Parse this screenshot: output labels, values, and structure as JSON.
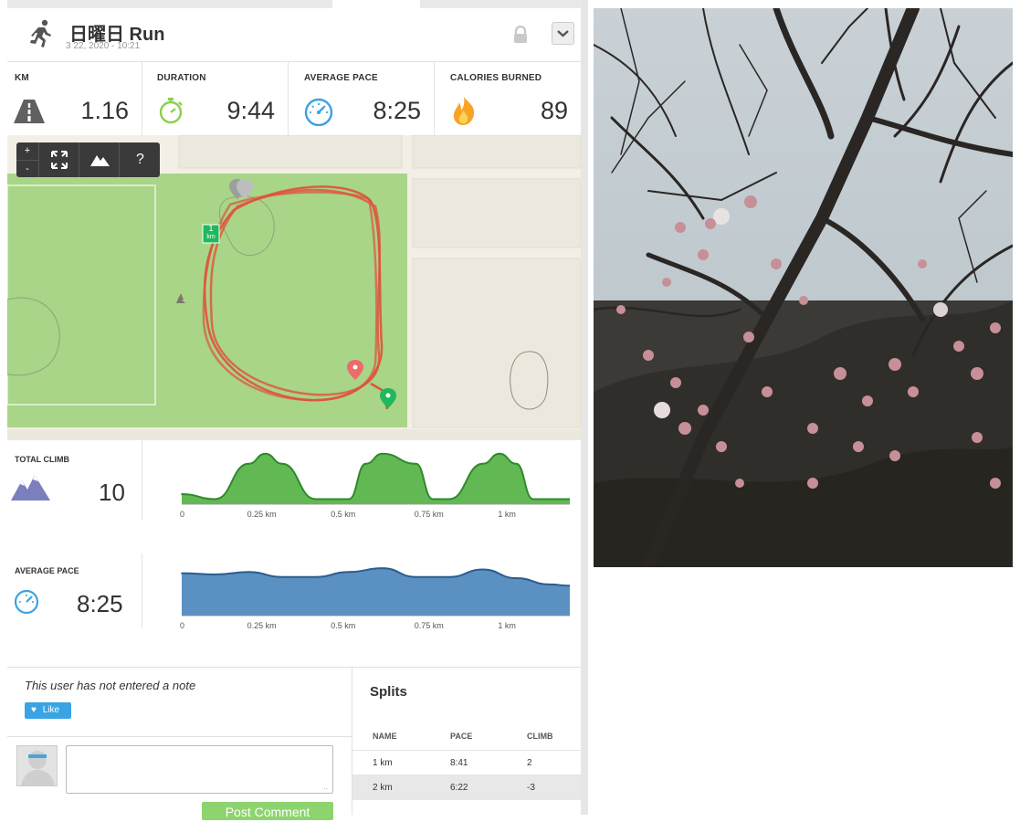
{
  "activity": {
    "title": "日曜日 Run",
    "date_time": "3 22, 2020  -  10:21"
  },
  "stats": [
    {
      "label": "KM",
      "value": "1.16",
      "icon": "road-icon"
    },
    {
      "label": "DURATION",
      "value": "9:44",
      "icon": "stopwatch-icon"
    },
    {
      "label": "AVERAGE PACE",
      "value": "8:25",
      "icon": "speedometer-icon"
    },
    {
      "label": "CALORIES BURNED",
      "value": "89",
      "icon": "flame-icon"
    }
  ],
  "map": {
    "zoom_in_label": "+",
    "zoom_out_label": "-",
    "help_label": "?",
    "km_marker": "1",
    "km_unit": "km"
  },
  "climb": {
    "label": "TOTAL CLIMB",
    "value": "10",
    "color": "#3a9a35",
    "ticks": [
      "0",
      "0.25 km",
      "0.5 km",
      "0.75 km",
      "1 km"
    ]
  },
  "pace": {
    "label": "AVERAGE PACE",
    "value": "8:25",
    "color": "#3f7fba",
    "ticks": [
      "0",
      "0.25 km",
      "0.5 km",
      "0.75 km",
      "1 km"
    ]
  },
  "note": {
    "text": "This user has not entered a note",
    "like_label": "Like"
  },
  "comment": {
    "post_label": "Post Comment"
  },
  "splits": {
    "title": "Splits",
    "headers": [
      "NAME",
      "PACE",
      "CLIMB"
    ],
    "rows": [
      {
        "name": "1 km",
        "pace": "8:41",
        "climb": "2"
      },
      {
        "name": "2 km",
        "pace": "6:22",
        "climb": "-3"
      }
    ]
  },
  "chart_data": [
    {
      "type": "area",
      "xlabel": "",
      "ylabel": "",
      "x": [
        0,
        0.1,
        0.2,
        0.25,
        0.3,
        0.4,
        0.45,
        0.5,
        0.55,
        0.6,
        0.7,
        0.75,
        0.8,
        0.9,
        0.95,
        1.0,
        1.05,
        1.16
      ],
      "values": [
        2,
        1,
        8,
        10,
        8,
        1,
        1,
        1,
        8,
        10,
        8,
        1,
        1,
        8,
        10,
        8,
        1,
        1
      ],
      "xticks": [
        "0",
        "0.25 km",
        "0.5 km",
        "0.75 km",
        "1 km"
      ]
    },
    {
      "type": "area",
      "xlabel": "",
      "ylabel": "",
      "x": [
        0,
        0.1,
        0.2,
        0.3,
        0.4,
        0.5,
        0.6,
        0.7,
        0.8,
        0.9,
        1.0,
        1.1,
        1.16
      ],
      "values": [
        0.68,
        0.66,
        0.7,
        0.62,
        0.62,
        0.7,
        0.76,
        0.62,
        0.62,
        0.74,
        0.6,
        0.5,
        0.48
      ],
      "xticks": [
        "0",
        "0.25 km",
        "0.5 km",
        "0.75 km",
        "1 km"
      ]
    }
  ]
}
